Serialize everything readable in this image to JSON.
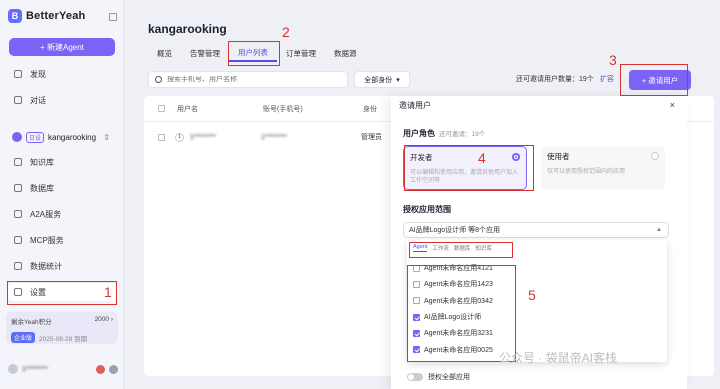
{
  "brand": {
    "logo_text": "BetterYeah"
  },
  "sidebar": {
    "new_agent_label": "+ 新建Agent",
    "items": [
      {
        "label": "发现"
      },
      {
        "label": "对话"
      }
    ],
    "workspace": {
      "badge": "日设",
      "name": "kangarooking"
    },
    "sub_items": [
      {
        "label": "知识库"
      },
      {
        "label": "数据库"
      },
      {
        "label": "A2A服务"
      },
      {
        "label": "MCP服务"
      },
      {
        "label": "数据统计"
      },
      {
        "label": "设置"
      }
    ],
    "credits": {
      "label": "剩余Yeah积分",
      "value": "2000 ›",
      "plan": "企业版",
      "expire": "2025-08-28 到期"
    },
    "user_name": "1********"
  },
  "main": {
    "title": "kangarooking",
    "tabs": [
      "概览",
      "告警管理",
      "用户列表",
      "订单管理",
      "数据源"
    ],
    "active_tab": 2,
    "search_placeholder": "搜索手机号、用户名称",
    "role_filter": "全部身份",
    "invite_count": "还可邀请用户数量：19个",
    "expand_link": "扩容",
    "invite_button": "+ 邀请用户",
    "table_headers": [
      "用户名",
      "账号(手机号)",
      "身份"
    ],
    "row": {
      "avatar": "1",
      "name": "1********",
      "phone": "1********",
      "role": "管理员"
    }
  },
  "modal": {
    "title": "邀请用户",
    "close": "×",
    "role_section": "用户角色",
    "role_sub": "还可邀请：19个",
    "roles": [
      {
        "title": "开发者",
        "desc": "可以编辑和使用应用，邀请其他用户加入工作空间等"
      },
      {
        "title": "使用者",
        "desc": "仅可以使用授权范围内的应用"
      }
    ],
    "scope_section": "授权应用范围",
    "scope_value": "AI品牌Logo设计师 等8个应用",
    "dropdown_tabs": [
      "Agent",
      "工作流",
      "数据库",
      "知识库"
    ],
    "apps": [
      {
        "label": "Agent未命名应用4121",
        "checked": false
      },
      {
        "label": "Agent未命名应用1423",
        "checked": false
      },
      {
        "label": "Agent未命名应用0342",
        "checked": false
      },
      {
        "label": "AI品牌Logo设计师",
        "checked": true
      },
      {
        "label": "Agent未命名应用3231",
        "checked": true
      },
      {
        "label": "Agent未命名应用0025",
        "checked": true
      }
    ],
    "authorize_all": "授权全部应用"
  },
  "annotations": [
    "1",
    "2",
    "3",
    "4",
    "5"
  ],
  "watermark": "公众号 · 袋鼠帝AI客栈"
}
